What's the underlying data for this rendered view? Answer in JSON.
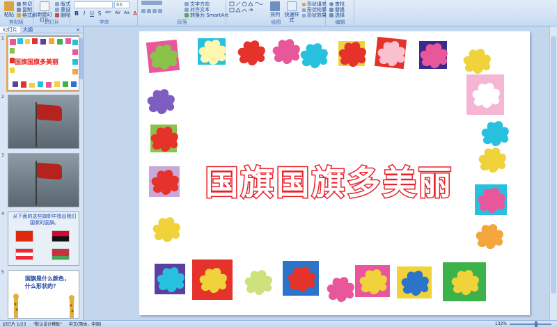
{
  "ribbon": {
    "clipboard": {
      "paste": "粘贴",
      "cut": "剪切",
      "copy": "复制",
      "format_painter": "格式刷",
      "label": "剪贴板"
    },
    "slides": {
      "new_slide": "新建幻灯片",
      "layout": "版式",
      "reset": "重设",
      "delete": "删除",
      "label": "幻灯片"
    },
    "font": {
      "font_size": "66",
      "label": "字体",
      "buttons": [
        "B",
        "I",
        "U",
        "S",
        "abc",
        "AV",
        "Aa",
        "A"
      ]
    },
    "paragraph": {
      "text_direction": "文字方向",
      "align_text": "对齐文本",
      "convert_smartart": "转换为 SmartArt",
      "label": "段落"
    },
    "drawing": {
      "arrange": "排列",
      "quick_styles": "快速样式",
      "shape_fill": "形状填充",
      "shape_outline": "形状轮廓",
      "shape_effects": "形状效果",
      "label": "绘图"
    },
    "editing": {
      "find": "查找",
      "replace": "替换",
      "select": "选择",
      "label": "编辑"
    }
  },
  "left_panel": {
    "tabs": [
      "幻灯片",
      "大纲"
    ],
    "close": "×",
    "thumbnails": [
      {
        "number": "1",
        "title": "国旗国旗多美丽"
      },
      {
        "number": "2"
      },
      {
        "number": "3"
      },
      {
        "number": "4",
        "text": "从下面的这些旗帜中找出我们国家的国旗。"
      },
      {
        "number": "5",
        "text": "国旗是什么颜色，什么形状的？"
      }
    ]
  },
  "slide": {
    "title": "国旗国旗多美丽"
  },
  "status_bar": {
    "slide_index": "幻灯片 1/23",
    "theme": "\"默认设计模板\"",
    "language": "中文(简体，中国)",
    "zoom": "132%"
  },
  "colors": {
    "title_stroke": "#e8212a",
    "ribbon_bg": "#d3e2f4",
    "workspace_bg": "#c4d6ec"
  }
}
